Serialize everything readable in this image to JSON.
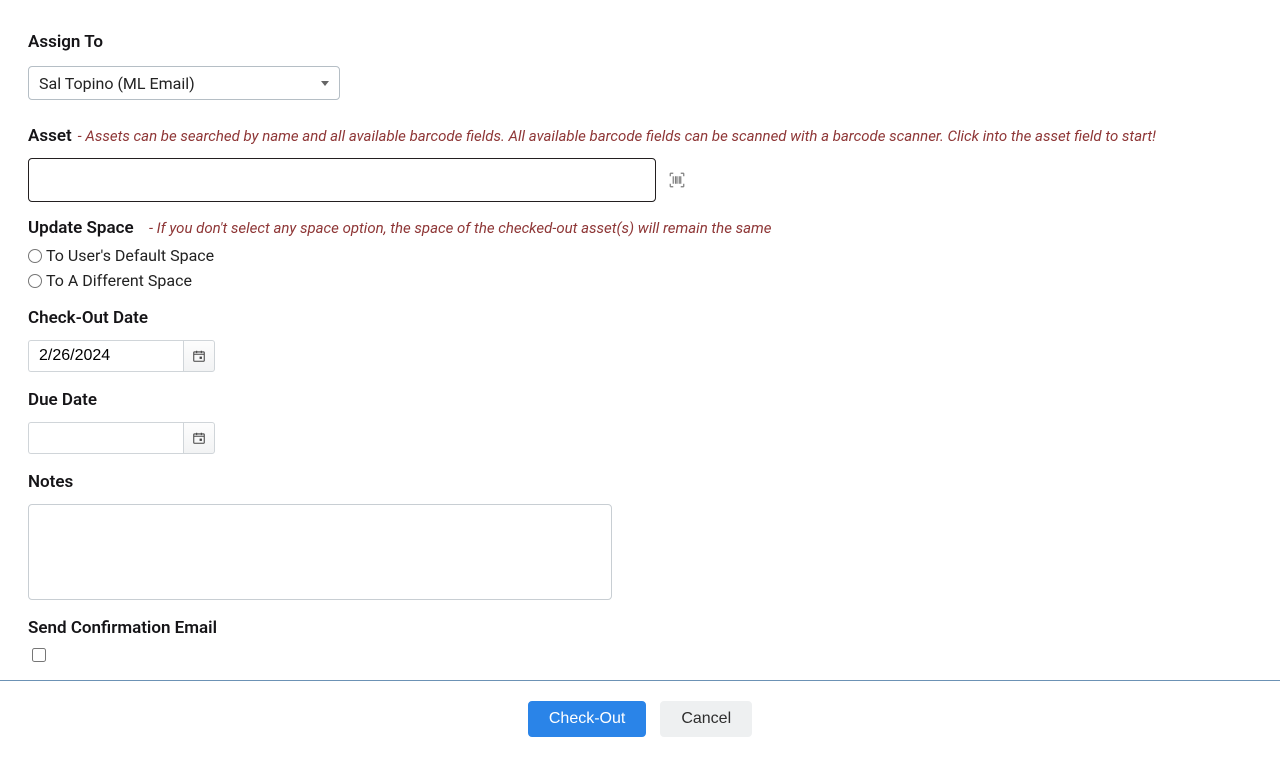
{
  "assign_to": {
    "label": "Assign To",
    "value": "Sal Topino (ML Email)"
  },
  "asset": {
    "label": "Asset",
    "hint_prefix": "- ",
    "hint": "Assets can be searched by name and all available barcode fields. All available barcode fields can be scanned with a barcode scanner. Click into the asset field to start!",
    "value": ""
  },
  "update_space": {
    "label": "Update Space",
    "hint_prefix": "- ",
    "hint": "If you don't select any space option, the space of the checked-out asset(s) will remain the same",
    "options": [
      "To User's Default Space",
      "To A Different Space"
    ]
  },
  "checkout_date": {
    "label": "Check-Out Date",
    "value": "2/26/2024"
  },
  "due_date": {
    "label": "Due Date",
    "value": ""
  },
  "notes": {
    "label": "Notes",
    "value": ""
  },
  "confirmation": {
    "label": "Send Confirmation Email",
    "checked": false
  },
  "footer": {
    "primary": "Check-Out",
    "secondary": "Cancel"
  }
}
